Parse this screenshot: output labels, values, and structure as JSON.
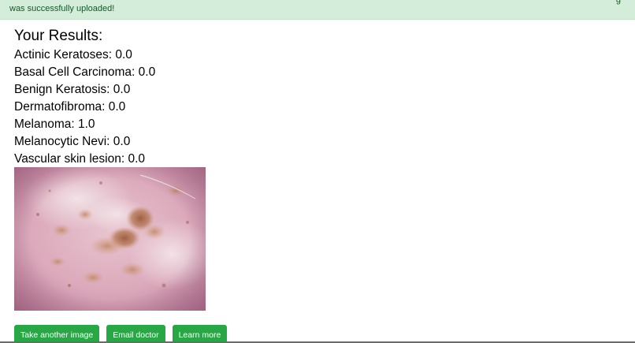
{
  "alert": {
    "message": "was successfully uploaded!",
    "edge_mark": "g"
  },
  "results": {
    "title": "Your Results:",
    "items": [
      {
        "label": "Actinic Keratoses: 0.0"
      },
      {
        "label": "Basal Cell Carcinoma: 0.0"
      },
      {
        "label": "Benign Keratosis: 0.0"
      },
      {
        "label": "Dermatofibroma: 0.0"
      },
      {
        "label": "Melanoma: 1.0"
      },
      {
        "label": "Melanocytic Nevi: 0.0"
      },
      {
        "label": "Vascular skin lesion: 0.0"
      }
    ]
  },
  "actions": {
    "take_another": "Take another image",
    "email_doctor": "Email doctor",
    "learn_more": "Learn more"
  },
  "colors": {
    "alert_bg": "#d4edda",
    "alert_text": "#155724",
    "button_bg": "#28a745"
  }
}
